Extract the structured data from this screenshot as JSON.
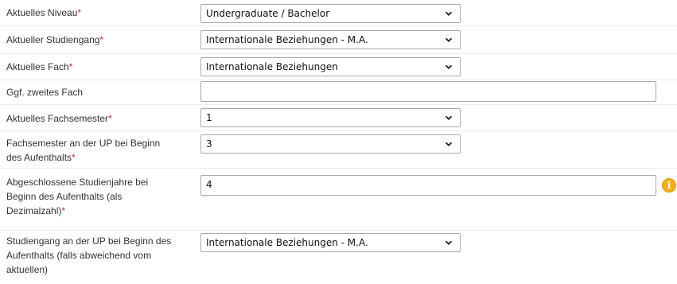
{
  "required_marker": "*",
  "info_icon_glyph": "i",
  "colors": {
    "required": "#cc2a2a",
    "info_icon": "#f2b01c",
    "border": "#a9a9a9"
  },
  "fields": [
    {
      "label": "Aktuelles Niveau",
      "required": true,
      "type": "select",
      "value": "Undergraduate / Bachelor"
    },
    {
      "label": "Aktueller Studiengang",
      "required": true,
      "type": "select",
      "value": "Internationale Beziehungen - M.A."
    },
    {
      "label": "Aktuelles Fach",
      "required": true,
      "type": "select",
      "value": "Internationale Beziehungen"
    },
    {
      "label": "Ggf. zweites Fach",
      "required": false,
      "type": "text",
      "value": ""
    },
    {
      "label": "Aktuelles Fachsemester",
      "required": true,
      "type": "select",
      "value": "1"
    },
    {
      "label": "Fachsemester an der UP bei Beginn des Aufenthalts",
      "required": true,
      "type": "select",
      "value": "3"
    },
    {
      "label": "Abgeschlossene Studienjahre bei Beginn des Aufenthalts (als Dezimalzahl)",
      "required": true,
      "type": "text",
      "value": "4",
      "icon": "info-icon"
    },
    {
      "label": "Studiengang an der UP bei Beginn des Aufenthalts (falls abweichend vom aktuellen)",
      "required": false,
      "type": "select",
      "value": "Internationale Beziehungen - M.A."
    }
  ]
}
